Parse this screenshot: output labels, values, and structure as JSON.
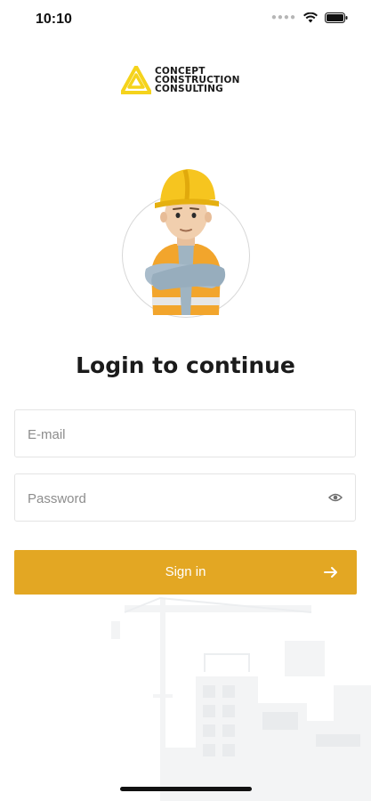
{
  "status_bar": {
    "time": "10:10",
    "icons": [
      "signal-dots-icon",
      "wifi-icon",
      "battery-icon"
    ]
  },
  "logo": {
    "lines": [
      "CONCEPT",
      "CONSTRUCTION",
      "CONSULTING"
    ],
    "brand_color": "#F5D31C"
  },
  "avatar": {
    "icon": "construction-worker-avatar"
  },
  "login": {
    "title": "Login to continue"
  },
  "form": {
    "email_placeholder": "E-mail",
    "password_placeholder": "Password",
    "password_toggle_icon": "eye-icon"
  },
  "signin": {
    "label": "Sign in",
    "color": "#E3A723",
    "icon": "arrow-right-icon"
  }
}
